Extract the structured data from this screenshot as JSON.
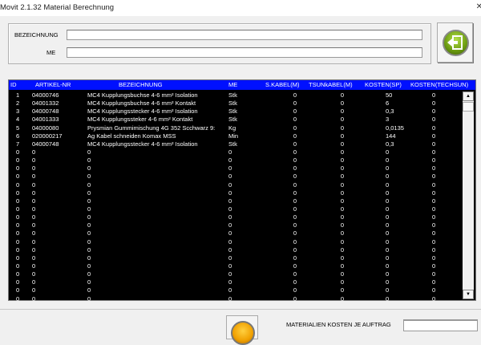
{
  "window": {
    "title": "Movit 2.1.32 Material Berechnung",
    "close": "✕"
  },
  "form": {
    "bezeichnung_label": "BEZEICHNUNG",
    "bezeichnung_value": "",
    "me_label": "ME",
    "me_value": ""
  },
  "table": {
    "columns": [
      "ID",
      "ARTIKEL-NR",
      "BEZEICHNUNG",
      "ME",
      "S.KABEL(M)",
      "TSUNkABEL(M)",
      "KOSTEN(SP)",
      "KOSTEN(TECHSUN)"
    ],
    "rows": [
      [
        "1",
        "04000746",
        "MC4 Kupplungsbuchse 4-6 mm² Isolation",
        "Stk",
        "0",
        "0",
        "50",
        "0"
      ],
      [
        "2",
        "04001332",
        "MC4 Kupplungsbuchse 4-6 mm² Kontakt",
        "Stk",
        "0",
        "0",
        "6",
        "0"
      ],
      [
        "3",
        "04000748",
        "MC4 Kupplungsstecker 4-6 mm² Isolation",
        "Stk",
        "0",
        "0",
        "0,3",
        "0"
      ],
      [
        "4",
        "04001333",
        "MC4 Kupplungssteker 4-6 mm² Kontakt",
        "Stk",
        "0",
        "0",
        "3",
        "0"
      ],
      [
        "5",
        "04000080",
        "Prysmian Gummimischung 4G 352 Scchwarz 9:",
        "Kg",
        "0",
        "0",
        "0,0135",
        "0"
      ],
      [
        "6",
        "020000217",
        "Ag Kabel schneiden Komax MSS",
        "Min",
        "0",
        "0",
        "144",
        "0"
      ],
      [
        "7",
        "04000748",
        "MC4 Kupplungsstecker 4-6 mm² Isolation",
        "Stk",
        "0",
        "0",
        "0,3",
        "0"
      ]
    ],
    "empty_row_value": "0",
    "empty_row_count": 19
  },
  "scrollbar": {
    "up": "▲",
    "down": "▼"
  },
  "footer": {
    "cost_label": "MATERIALIEN KOSTEN JE AUFTRAG",
    "cost_value": ""
  }
}
